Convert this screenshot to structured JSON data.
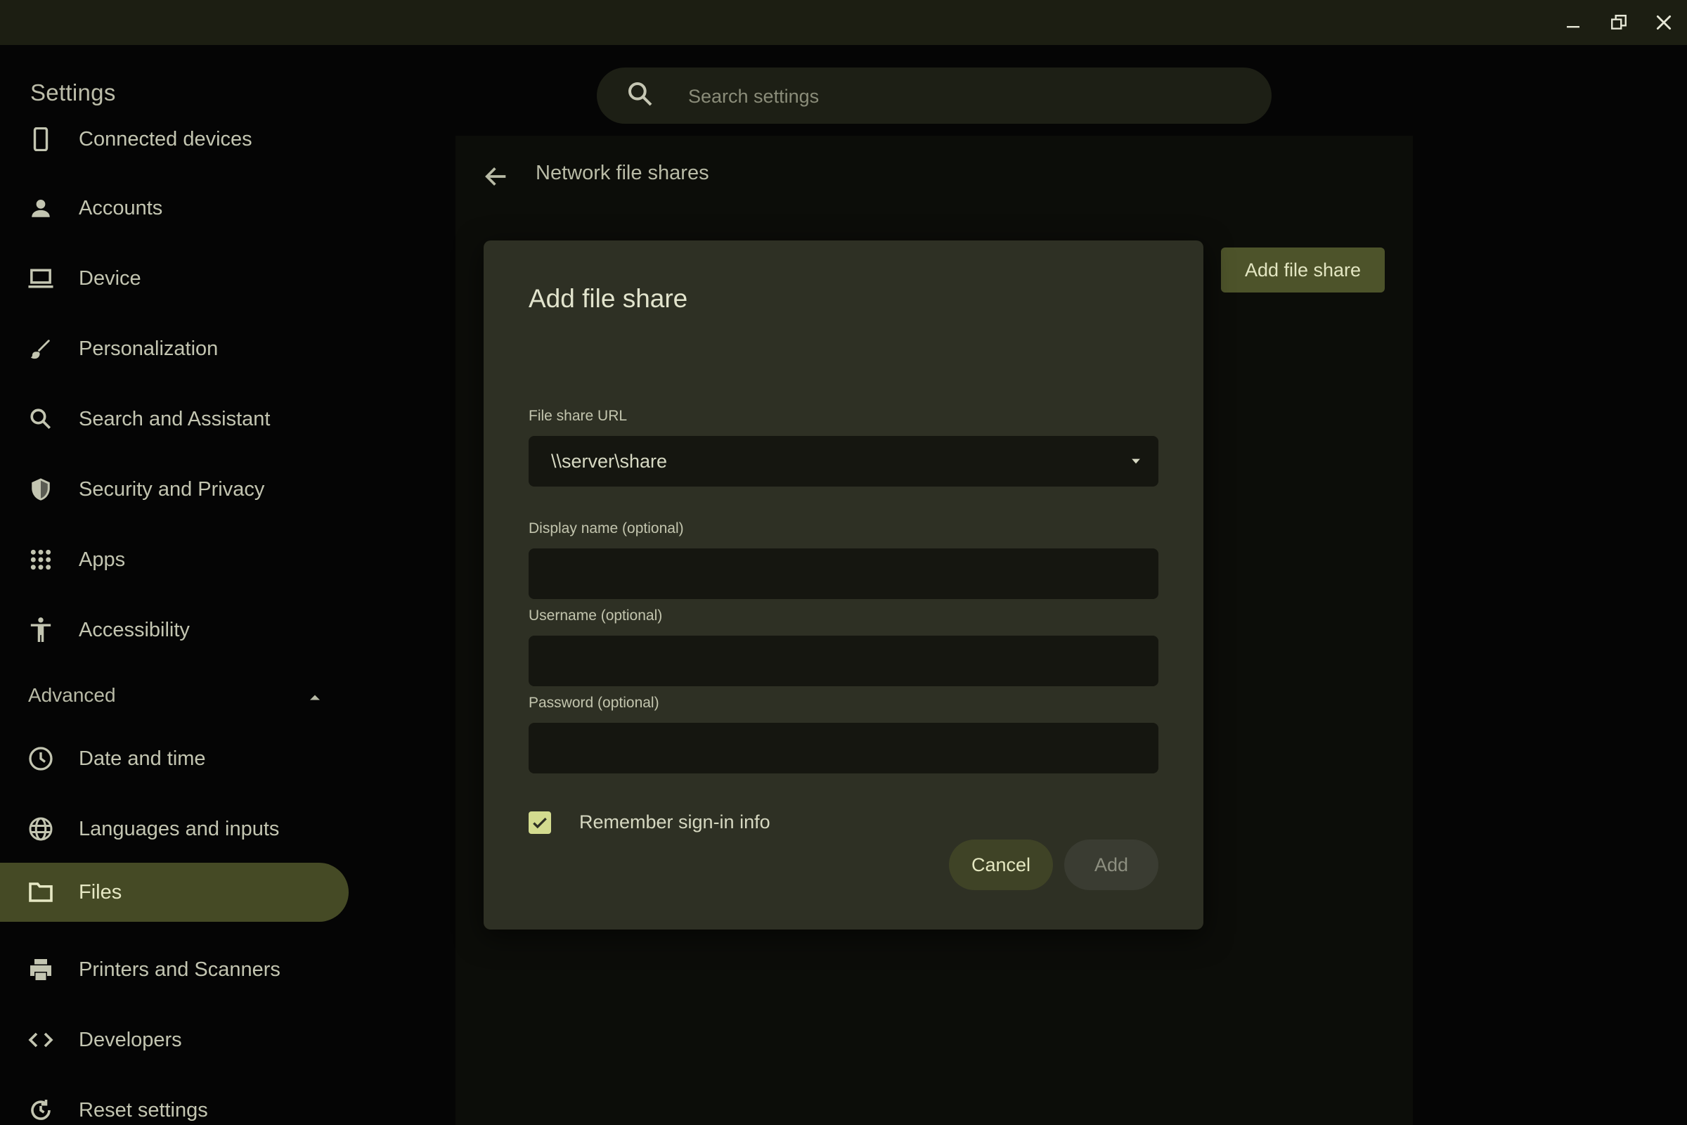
{
  "window": {
    "controls": [
      {
        "name": "minimize-icon"
      },
      {
        "name": "restore-icon"
      },
      {
        "name": "close-icon"
      }
    ]
  },
  "sidebar": {
    "title": "Settings",
    "items": [
      {
        "label": "Connected devices",
        "icon": "phone-icon"
      },
      {
        "label": "Accounts",
        "icon": "person-icon"
      },
      {
        "label": "Device",
        "icon": "laptop-icon"
      },
      {
        "label": "Personalization",
        "icon": "brush-icon"
      },
      {
        "label": "Search and Assistant",
        "icon": "search-icon"
      },
      {
        "label": "Security and Privacy",
        "icon": "shield-icon"
      },
      {
        "label": "Apps",
        "icon": "apps-grid-icon"
      },
      {
        "label": "Accessibility",
        "icon": "accessibility-icon"
      }
    ],
    "advanced_label": "Advanced",
    "advanced_items": [
      {
        "label": "Date and time",
        "icon": "clock-icon"
      },
      {
        "label": "Languages and inputs",
        "icon": "globe-icon"
      },
      {
        "label": "Files",
        "icon": "folder-icon",
        "selected": true
      },
      {
        "label": "Printers and Scanners",
        "icon": "printer-icon"
      },
      {
        "label": "Developers",
        "icon": "code-icon"
      },
      {
        "label": "Reset settings",
        "icon": "reset-icon"
      }
    ]
  },
  "search": {
    "placeholder": "Search settings"
  },
  "page": {
    "title": "Network file shares",
    "add_button": "Add file share"
  },
  "dialog": {
    "title": "Add file share",
    "url_label": "File share URL",
    "url_value": "\\\\server\\share",
    "display_name_label": "Display name (optional)",
    "display_name_value": "",
    "username_label": "Username (optional)",
    "username_value": "",
    "password_label": "Password (optional)",
    "password_value": "",
    "remember_label": "Remember sign-in info",
    "remember_checked": true,
    "cancel_label": "Cancel",
    "add_label": "Add"
  },
  "colors": {
    "accent": "#d3db8f",
    "selected_nav": "#454a25",
    "dialog_bg": "#2e3024"
  }
}
